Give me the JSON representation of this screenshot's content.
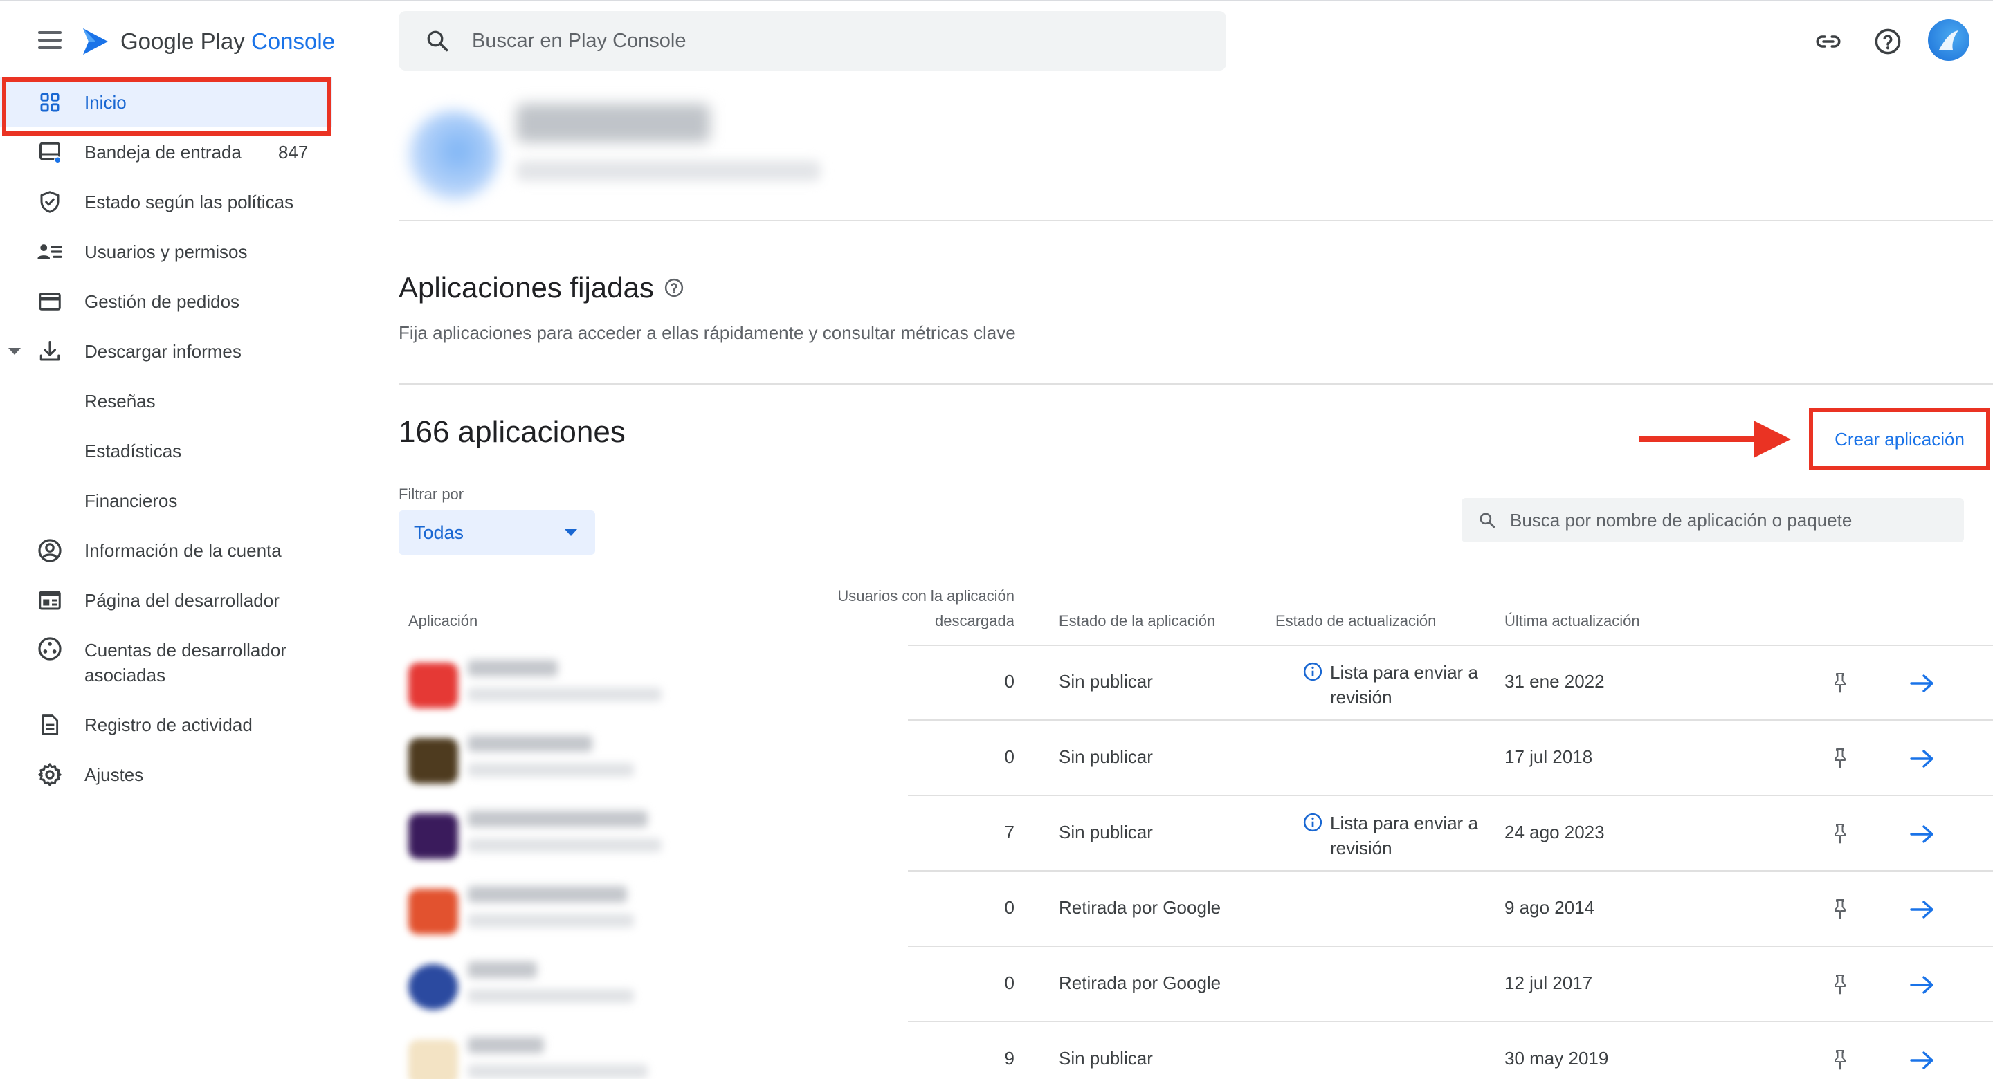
{
  "header": {
    "brand_name": "Google Play",
    "brand_accent": "Console",
    "search_placeholder": "Buscar en Play Console"
  },
  "sidebar": {
    "items": [
      {
        "label": "Inicio",
        "icon": "dashboard-icon",
        "active": true
      },
      {
        "label": "Bandeja de entrada",
        "icon": "inbox-icon",
        "badge": "847"
      },
      {
        "label": "Estado según las políticas",
        "icon": "shield-icon"
      },
      {
        "label": "Usuarios y permisos",
        "icon": "users-icon"
      },
      {
        "label": "Gestión de pedidos",
        "icon": "credit-card-icon"
      },
      {
        "label": "Descargar informes",
        "icon": "download-icon",
        "expanded": true
      },
      {
        "label": "Reseñas"
      },
      {
        "label": "Estadísticas"
      },
      {
        "label": "Financieros"
      },
      {
        "label": "Información de la cuenta",
        "icon": "account-circle-icon"
      },
      {
        "label": "Página del desarrollador",
        "icon": "web-page-icon"
      },
      {
        "label": "Cuentas de desarrollador asociadas",
        "icon": "linked-accounts-icon"
      },
      {
        "label": "Registro de actividad",
        "icon": "document-icon"
      },
      {
        "label": "Ajustes",
        "icon": "gear-icon"
      }
    ]
  },
  "pinned": {
    "title": "Aplicaciones fijadas",
    "subtitle": "Fija aplicaciones para acceder a ellas rápidamente y consultar métricas clave"
  },
  "apps": {
    "count_label": "166 aplicaciones",
    "create_button": "Crear aplicación",
    "filter_label": "Filtrar por",
    "filter_value": "Todas",
    "search_placeholder": "Busca por nombre de aplicación o paquete",
    "columns": {
      "app": "Aplicación",
      "users_line1": "Usuarios con la aplicación",
      "users_line2": "descargada",
      "status": "Estado de la aplicación",
      "update_status": "Estado de actualización",
      "last_update": "Última actualización"
    },
    "rows": [
      {
        "users": "0",
        "status": "Sin publicar",
        "update_status": "Lista para enviar a revisión",
        "last_update": "31 ene 2022",
        "thumb_color": "#e53935"
      },
      {
        "users": "0",
        "status": "Sin publicar",
        "update_status": "",
        "last_update": "17 jul 2018",
        "thumb_color": "#4e3b1f"
      },
      {
        "users": "7",
        "status": "Sin publicar",
        "update_status": "Lista para enviar a revisión",
        "last_update": "24 ago 2023",
        "thumb_color": "#3a1b5c"
      },
      {
        "users": "0",
        "status": "Retirada por Google",
        "update_status": "",
        "last_update": "9 ago 2014",
        "thumb_color": "#e2522f"
      },
      {
        "users": "0",
        "status": "Retirada por Google",
        "update_status": "",
        "last_update": "12 jul 2017",
        "thumb_color": "#2b4aa0"
      },
      {
        "users": "9",
        "status": "Sin publicar",
        "update_status": "",
        "last_update": "30 may 2019",
        "thumb_color": "#f3e3c4"
      }
    ]
  },
  "colors": {
    "accent": "#1a73e8",
    "annotation_red": "#ea3323",
    "active_bg": "#e8f0fe"
  }
}
